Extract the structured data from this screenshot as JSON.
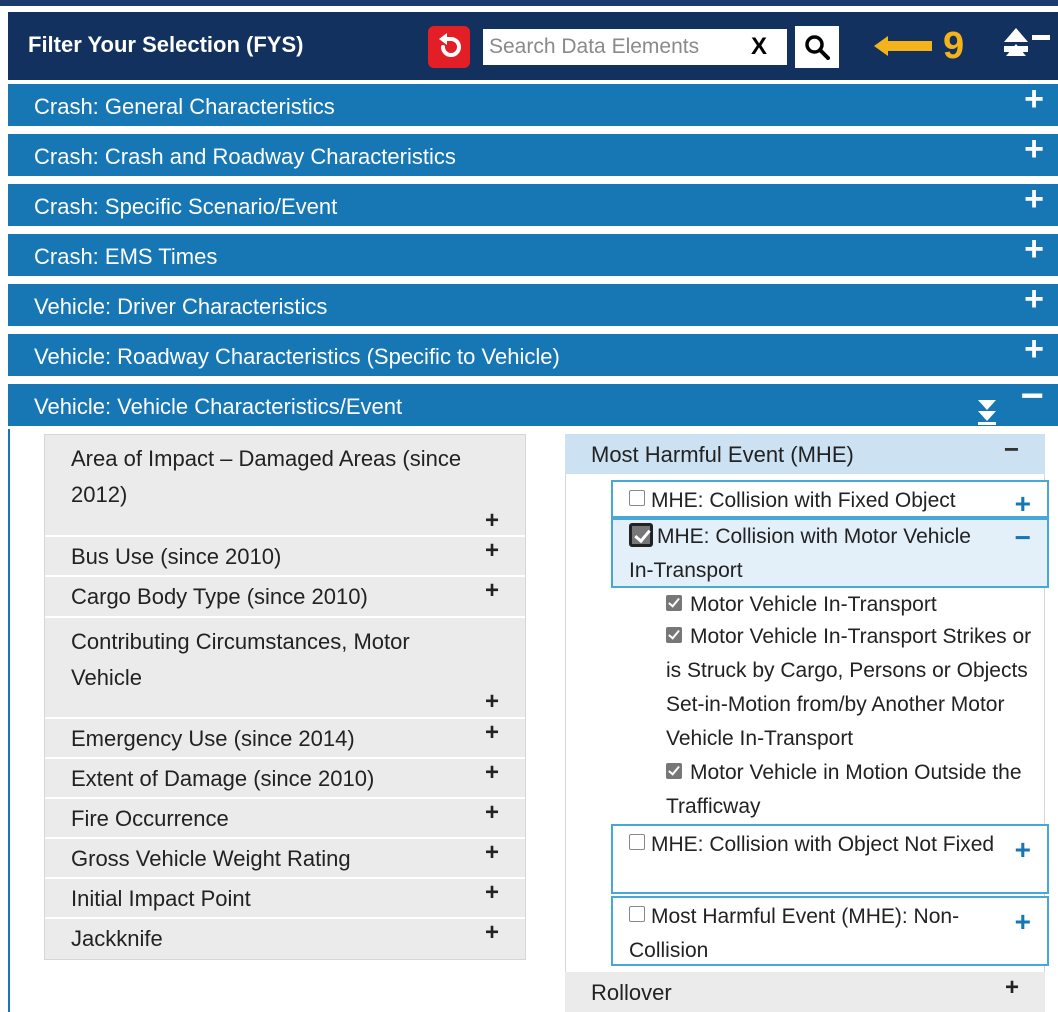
{
  "header": {
    "title": "Filter Your Selection (FYS)",
    "search_placeholder": "Search Data Elements",
    "clear_label": "X",
    "annotation_number": "9"
  },
  "sections": [
    {
      "label": "Crash: General Characteristics",
      "toggle": "+"
    },
    {
      "label": "Crash: Crash and Roadway Characteristics",
      "toggle": "+"
    },
    {
      "label": "Crash: Specific Scenario/Event",
      "toggle": "+"
    },
    {
      "label": "Crash: EMS Times",
      "toggle": "+"
    },
    {
      "label": "Vehicle: Driver Characteristics",
      "toggle": "+"
    },
    {
      "label": "Vehicle: Roadway Characteristics (Specific to Vehicle)",
      "toggle": "+"
    },
    {
      "label": "Vehicle: Vehicle Characteristics/Event",
      "toggle": "−"
    }
  ],
  "left_items": [
    {
      "label": "Area of Impact – Damaged Areas (since 2012)",
      "toggle": "+"
    },
    {
      "label": "Bus Use (since 2010)",
      "toggle": "+"
    },
    {
      "label": "Cargo Body Type (since 2010)",
      "toggle": "+"
    },
    {
      "label": "Contributing Circumstances, Motor Vehicle",
      "toggle": "+"
    },
    {
      "label": "Emergency Use (since 2014)",
      "toggle": "+"
    },
    {
      "label": "Extent of Damage (since 2010)",
      "toggle": "+"
    },
    {
      "label": "Fire Occurrence",
      "toggle": "+"
    },
    {
      "label": "Gross Vehicle Weight Rating",
      "toggle": "+"
    },
    {
      "label": "Initial Impact Point",
      "toggle": "+"
    },
    {
      "label": "Jackknife",
      "toggle": "+"
    }
  ],
  "mhe": {
    "title": "Most Harmful Event (MHE)",
    "toggle": "−",
    "groups": [
      {
        "label": "MHE: Collision with Fixed Object",
        "toggle": "+",
        "checked": false
      },
      {
        "label": "MHE: Collision with Motor Vehicle In-Transport",
        "toggle": "−",
        "checked": true
      },
      {
        "label": "MHE: Collision with Object Not Fixed",
        "toggle": "+",
        "checked": false
      },
      {
        "label": "Most Harmful Event (MHE): Non-Collision",
        "toggle": "+",
        "checked": false
      }
    ],
    "options": [
      {
        "label": "Motor Vehicle In-Transport",
        "checked": true
      },
      {
        "label": "Motor Vehicle In-Transport Strikes or is Struck by Cargo, Persons or Objects Set-in-Motion from/by Another Motor Vehicle In-Transport",
        "checked": true
      },
      {
        "label": "Motor Vehicle in Motion Outside the Trafficway",
        "checked": true
      }
    ]
  },
  "rollover": {
    "label": "Rollover",
    "toggle": "+"
  },
  "colors": {
    "header_bg": "#13315e",
    "section_bg": "#1777b5",
    "reset_red": "#e21f26",
    "annotation_yellow": "#f5b31b",
    "mhe_header_bg": "#cce2f3"
  }
}
